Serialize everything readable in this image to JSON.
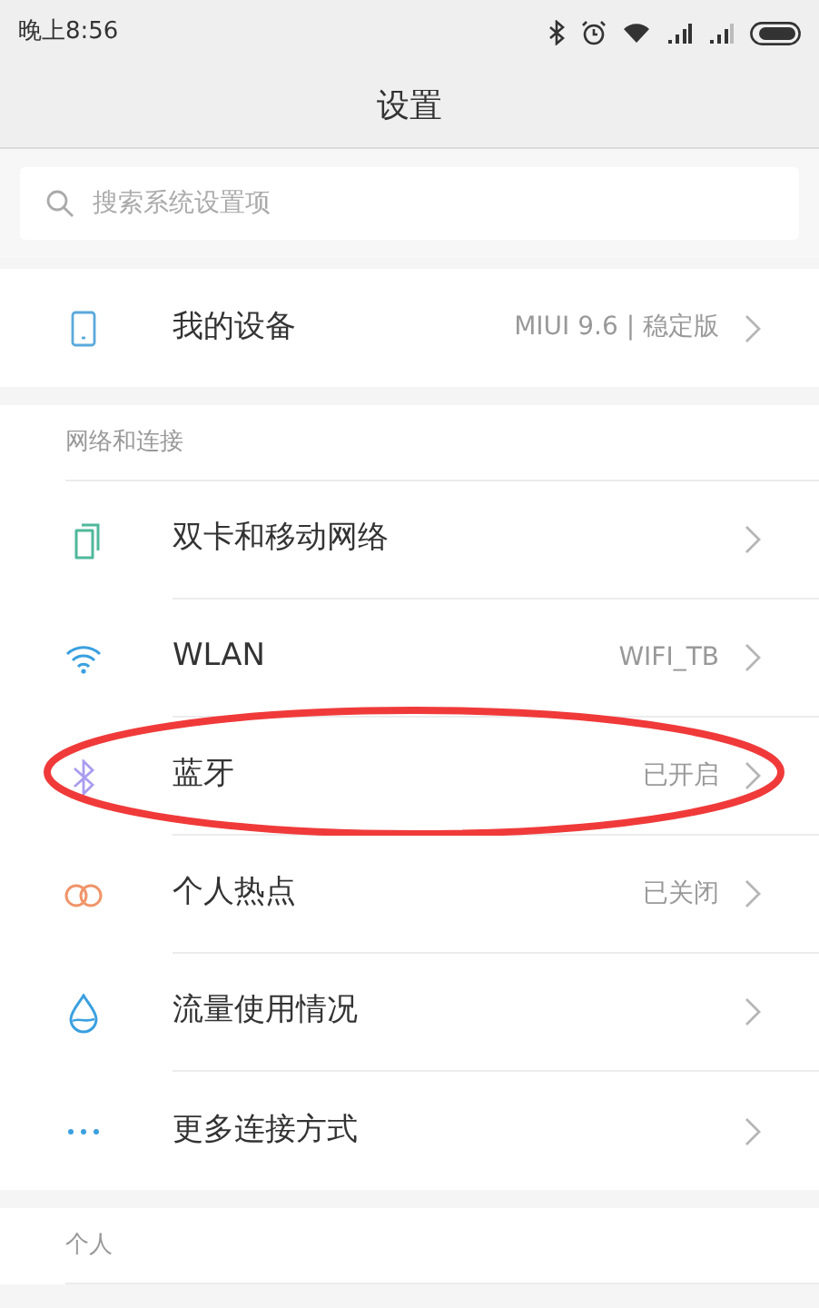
{
  "status_bar": {
    "time": "晚上8:56"
  },
  "title": "设置",
  "search": {
    "placeholder": "搜索系统设置项"
  },
  "device": {
    "label": "我的设备",
    "value": "MIUI 9.6 | 稳定版"
  },
  "sections": [
    {
      "header": "网络和连接",
      "items": [
        {
          "label": "双卡和移动网络",
          "highlighted": false
        },
        {
          "label": "WLAN",
          "value": "WIFI_TB",
          "highlighted": false
        },
        {
          "label": "蓝牙",
          "value": "已开启",
          "highlighted": true
        },
        {
          "label": "个人热点",
          "value": "已关闭",
          "highlighted": false
        },
        {
          "label": "流量使用情况",
          "highlighted": false
        },
        {
          "label": "更多连接方式",
          "highlighted": false
        }
      ]
    },
    {
      "header": "个人"
    }
  ]
}
